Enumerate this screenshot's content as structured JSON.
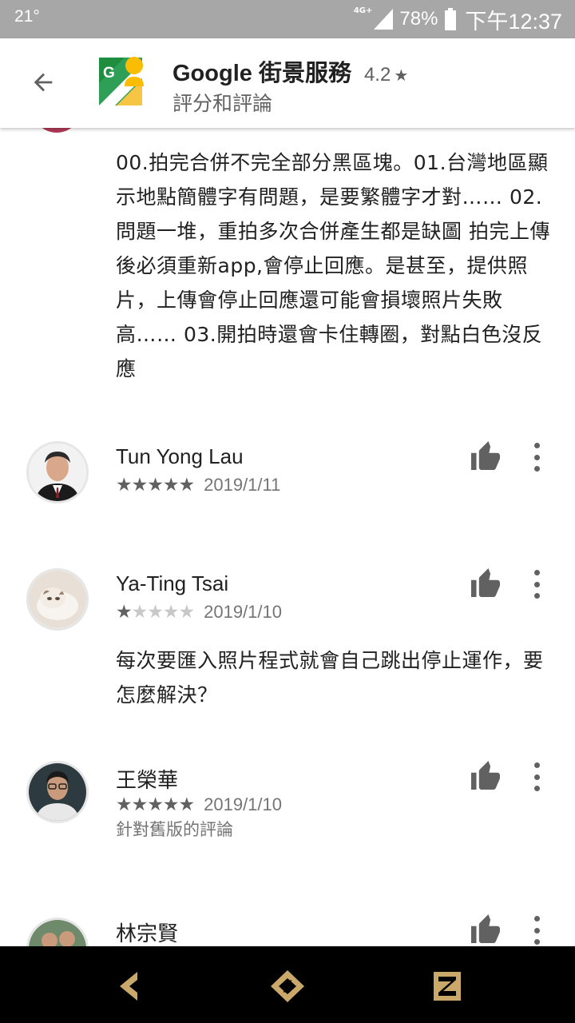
{
  "status_bar": {
    "temperature": "21°",
    "network": "4G+",
    "battery": "78%",
    "time": "下午12:37"
  },
  "header": {
    "back_icon": "arrow-left-icon",
    "app_icon": "street-view-app-icon",
    "app_name": "Google 街景服務",
    "rating": "4.2",
    "rating_star": "★",
    "subtitle": "評分和評論"
  },
  "reviews_top": {
    "partial_review_text": "00.拍完合併不完全部分黑區塊。01.台灣地區顯示地點簡體字有問題，是要繁體字才對…… 02.問題一堆，重拍多次合併產生都是缺圖 拍完上傳後必須重新app,會停止回應。是甚至，提供照片，上傳會停止回應還可能會損壞照片失敗高…… 03.開拍時還會卡住轉圈，對點白色沒反應"
  },
  "reviews": [
    {
      "author": "Tun Yong Lau",
      "stars": 5,
      "date": "2019/1/11",
      "text": "",
      "note": ""
    },
    {
      "author": "Ya-Ting Tsai",
      "stars": 1,
      "date": "2019/1/10",
      "text": "每次要匯入照片程式就會自己跳出停止運作，要怎麼解決？",
      "note": ""
    },
    {
      "author": "王榮華",
      "stars": 5,
      "date": "2019/1/10",
      "text": "",
      "note": "針對舊版的評論"
    },
    {
      "author": "林宗賢",
      "stars": 0,
      "date": "",
      "text": "",
      "note": ""
    }
  ],
  "nav_bar": {
    "back_icon": "nav-back-icon",
    "home_icon": "nav-home-icon",
    "recents_icon": "nav-recents-icon",
    "accent_color": "#c9a86a"
  }
}
